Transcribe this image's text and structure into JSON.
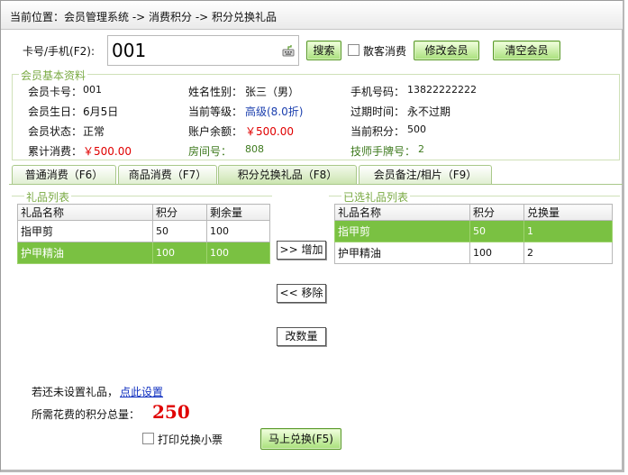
{
  "breadcrumb": "当前位置：会员管理系统 -> 消费积分 -> 积分兑换礼品",
  "search": {
    "card_label": "卡号/手机(F2):",
    "card_value": "001",
    "search_btn": "搜索",
    "walkin_label": "散客消费",
    "edit_btn": "修改会员",
    "clear_btn": "清空会员"
  },
  "member": {
    "group_title": "会员基本资料",
    "card_no_label": "会员卡号：",
    "card_no": "001",
    "name_label": "姓名性别：",
    "name": "张三（男）",
    "phone_label": "手机号码：",
    "phone": "13822222222",
    "birthday_label": "会员生日：",
    "birthday": "6月5日",
    "level_label": "当前等级：",
    "level": "高级(8.0折)",
    "expiry_label": "过期时间：",
    "expiry": "永不过期",
    "status_label": "会员状态：",
    "status": "正常",
    "balance_label": "账户余额：",
    "balance": "￥500.00",
    "points_label": "当前积分：",
    "points": "500",
    "total_label": "累计消费：",
    "total": "￥500.00",
    "room_label": "房间号：",
    "room": "808",
    "tech_label": "技师手牌号：",
    "tech": "2"
  },
  "tabs": [
    {
      "label": "普通消费（F6）"
    },
    {
      "label": "商品消费（F7）"
    },
    {
      "label": "积分兑换礼品（F8）"
    },
    {
      "label": "会员备注/相片（F9）"
    }
  ],
  "gift_list": {
    "title": "礼品列表",
    "headers": [
      "礼品名称",
      "积分",
      "剩余量"
    ],
    "rows": [
      {
        "name": "指甲剪",
        "points": "50",
        "remain": "100"
      },
      {
        "name": "护甲精油",
        "points": "100",
        "remain": "100"
      }
    ]
  },
  "selected_list": {
    "title": "已选礼品列表",
    "headers": [
      "礼品名称",
      "积分",
      "兑换量"
    ],
    "rows": [
      {
        "name": "指甲剪",
        "points": "50",
        "qty": "1"
      },
      {
        "name": "护甲精油",
        "points": "100",
        "qty": "2"
      }
    ]
  },
  "actions": {
    "add": ">> 增加",
    "remove": "<< 移除",
    "change_qty": "改数量"
  },
  "footer": {
    "hint": "若还未设置礼品，",
    "hint_link": "点此设置",
    "total_label": "所需花费的积分总量：",
    "total_value": "250",
    "print_label": "打印兑换小票",
    "redeem_btn": "马上兑换(F5)"
  },
  "colors": {
    "accent_green": "#7ac142",
    "red_text": "#e00000",
    "blue_text": "#1b3fae"
  }
}
